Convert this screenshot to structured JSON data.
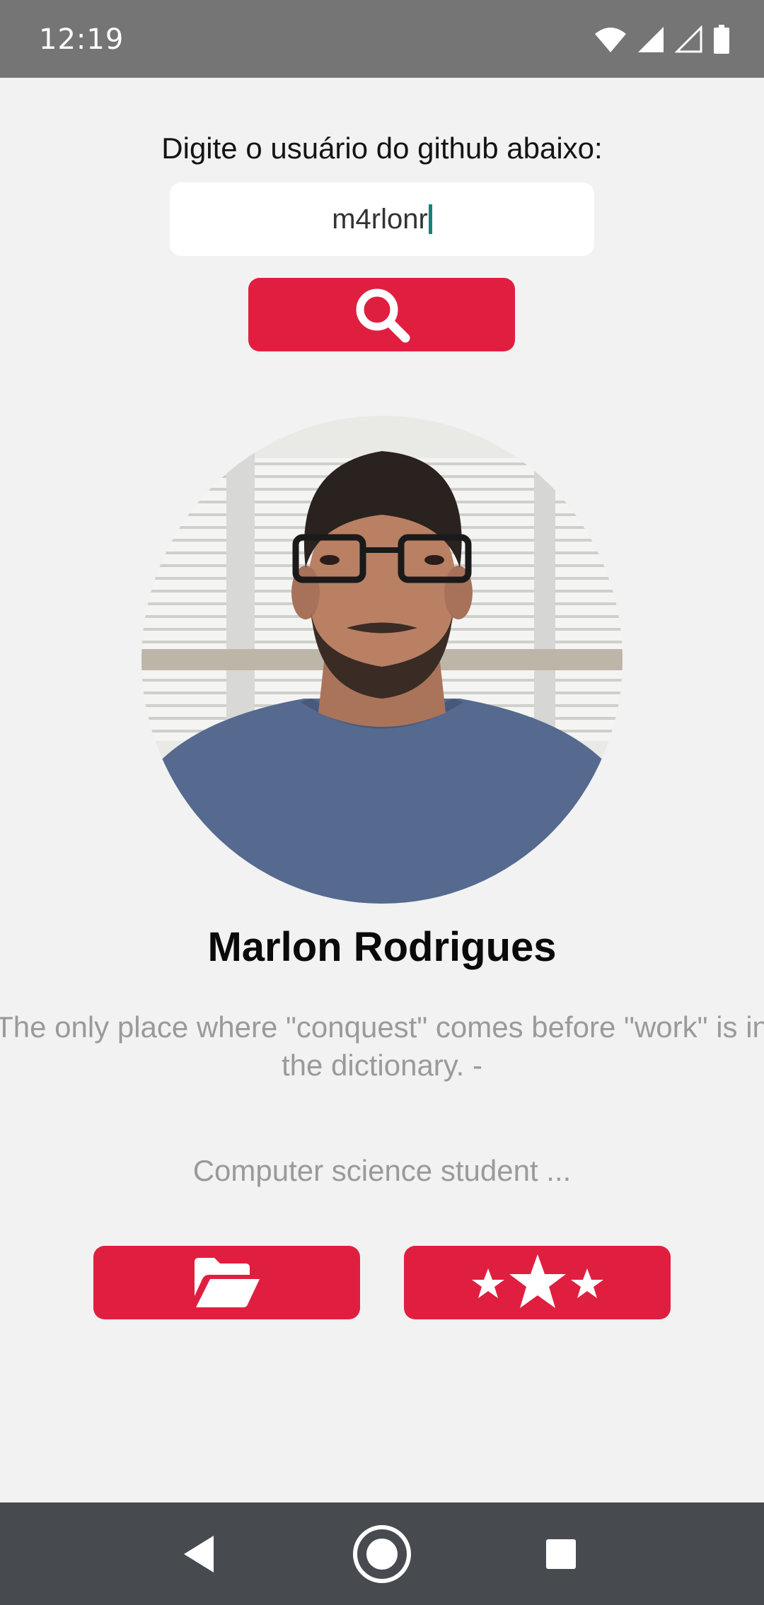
{
  "status_bar": {
    "time": "12:19",
    "icons": [
      "wifi-icon",
      "signal-icon",
      "signal-outline-icon",
      "battery-icon"
    ]
  },
  "search": {
    "prompt": "Digite o usuário do github abaixo:",
    "value": "m4rlonr",
    "button_icon": "search-icon"
  },
  "profile": {
    "name": "Marlon Rodrigues",
    "bio": "The only place where \"conquest\" comes before \"work\" is in the dictionary. -",
    "company": "Computer science student ..."
  },
  "actions": {
    "repos_icon": "folder-open-icon",
    "starred_icon": "stars-icon"
  },
  "nav_bar": {
    "icons": [
      "back-icon",
      "home-icon",
      "recents-icon"
    ]
  },
  "colors": {
    "accent": "#e01f40",
    "background": "#f2f2f2",
    "status_bar": "#757575",
    "nav_bar": "#474b4f",
    "cursor": "#118577"
  }
}
